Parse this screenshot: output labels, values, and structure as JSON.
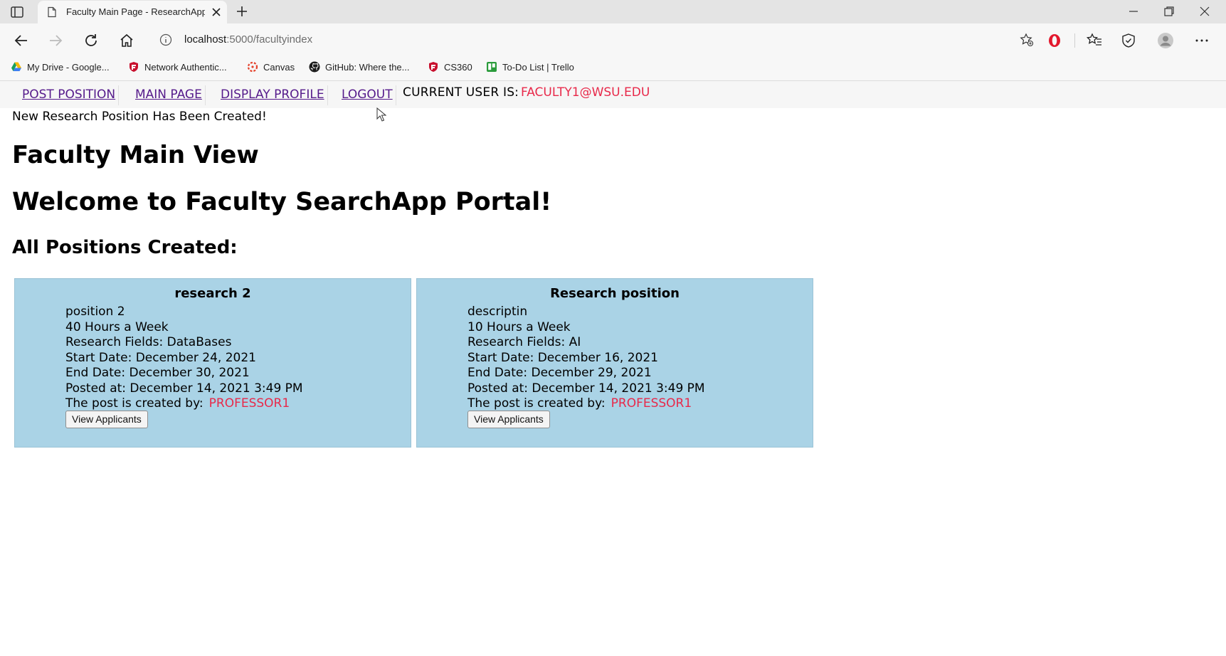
{
  "browser": {
    "tab_title": "Faculty Main Page - ResearchApp",
    "address": {
      "host": "localhost",
      "path": ":5000/facultyindex"
    },
    "bookmarks": [
      {
        "label": "My Drive - Google...",
        "icon": "google-drive-icon"
      },
      {
        "label": "Network Authentic...",
        "icon": "shield-icon"
      },
      {
        "label": "Canvas",
        "icon": "canvas-icon"
      },
      {
        "label": "GitHub: Where the...",
        "icon": "github-icon"
      },
      {
        "label": "CS360",
        "icon": "shield-icon"
      },
      {
        "label": "To-Do List | Trello",
        "icon": "trello-icon"
      }
    ]
  },
  "nav": {
    "post_position": "POST POSITION",
    "main_page": "MAIN PAGE",
    "display_profile": "DISPLAY PROFILE",
    "logout": "LOGOUT",
    "current_user_label": "CURRENT USER IS:",
    "current_user": "FACULTY1@WSU.EDU"
  },
  "flash_message": "New Research Position Has Been Created!",
  "headings": {
    "main_view": "Faculty Main View",
    "welcome": "Welcome to Faculty SearchApp Portal!",
    "all_positions": "All Positions Created:"
  },
  "positions": [
    {
      "title": "research 2",
      "description": "position 2",
      "hours": "40 Hours a Week",
      "fields": "Research Fields: DataBases",
      "start": "Start Date: December 24, 2021",
      "end": "End Date: December 30, 2021",
      "posted": "Posted at: December 14, 2021 3:49 PM",
      "created_by_label": "The post is created by:",
      "created_by": "PROFESSOR1",
      "button": "View Applicants"
    },
    {
      "title": "Research position",
      "description": "descriptin",
      "hours": "10 Hours a Week",
      "fields": "Research Fields: AI",
      "start": "Start Date: December 16, 2021",
      "end": "End Date: December 29, 2021",
      "posted": "Posted at: December 14, 2021 3:49 PM",
      "created_by_label": "The post is created by:",
      "created_by": "PROFESSOR1",
      "button": "View Applicants"
    }
  ],
  "colors": {
    "card_bg": "#aad3e6",
    "user_accent": "#e8294a",
    "visited_link": "#551a8b"
  }
}
